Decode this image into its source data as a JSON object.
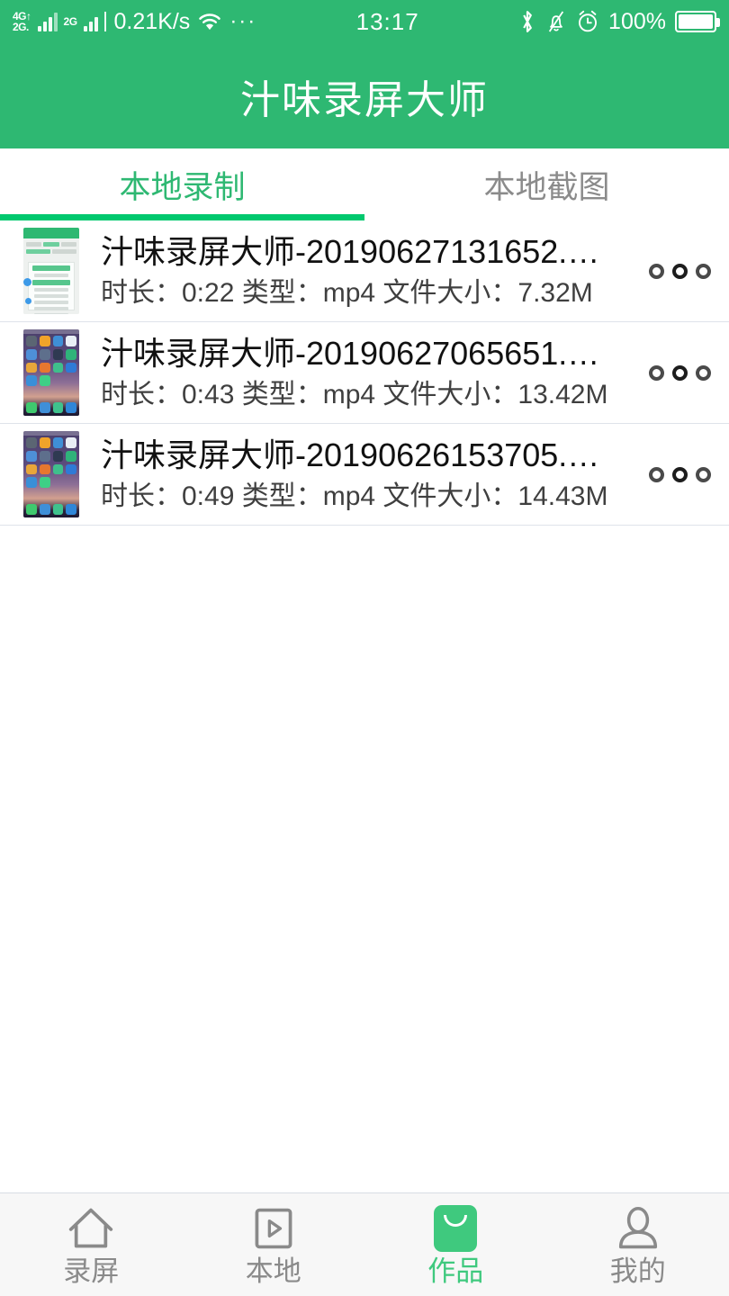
{
  "status_bar": {
    "network_label_top": "4G↑",
    "network_label_bottom": "2G.",
    "network_label_second": "2G",
    "net_speed": "0.21K/s",
    "overflow": "···",
    "time": "13:17",
    "battery_percent": "100%",
    "icons": [
      "wifi-icon",
      "bluetooth-icon",
      "bell-muted-icon",
      "alarm-clock-icon",
      "battery-icon"
    ]
  },
  "header": {
    "title": "汁味录屏大师"
  },
  "tabs": [
    {
      "label": "本地录制",
      "active": true
    },
    {
      "label": "本地截图",
      "active": false
    }
  ],
  "list": {
    "items": [
      {
        "title": "汁味录屏大师-20190627131652.…",
        "meta": "时长：0:22 类型：mp4 文件大小：7.32M",
        "duration": "0:22",
        "type": "mp4",
        "size": "7.32M",
        "thumb": "app"
      },
      {
        "title": "汁味录屏大师-20190627065651.…",
        "meta": "时长：0:43 类型：mp4 文件大小：13.42M",
        "duration": "0:43",
        "type": "mp4",
        "size": "13.42M",
        "thumb": "home"
      },
      {
        "title": "汁味录屏大师-20190626153705.…",
        "meta": "时长：0:49 类型：mp4 文件大小：14.43M",
        "duration": "0:49",
        "type": "mp4",
        "size": "14.43M",
        "thumb": "home"
      }
    ]
  },
  "bottom_nav": [
    {
      "label": "录屏",
      "icon": "home-icon",
      "active": false
    },
    {
      "label": "本地",
      "icon": "video-play-icon",
      "active": false
    },
    {
      "label": "作品",
      "icon": "bag-icon",
      "active": true
    },
    {
      "label": "我的",
      "icon": "person-icon",
      "active": false
    }
  ],
  "colors": {
    "brand_green": "#2EB872",
    "accent_green": "#00C86E",
    "nav_active_green": "#3FC97E",
    "divider": "#dfe3ea",
    "nav_bg": "#F7F7F7"
  }
}
